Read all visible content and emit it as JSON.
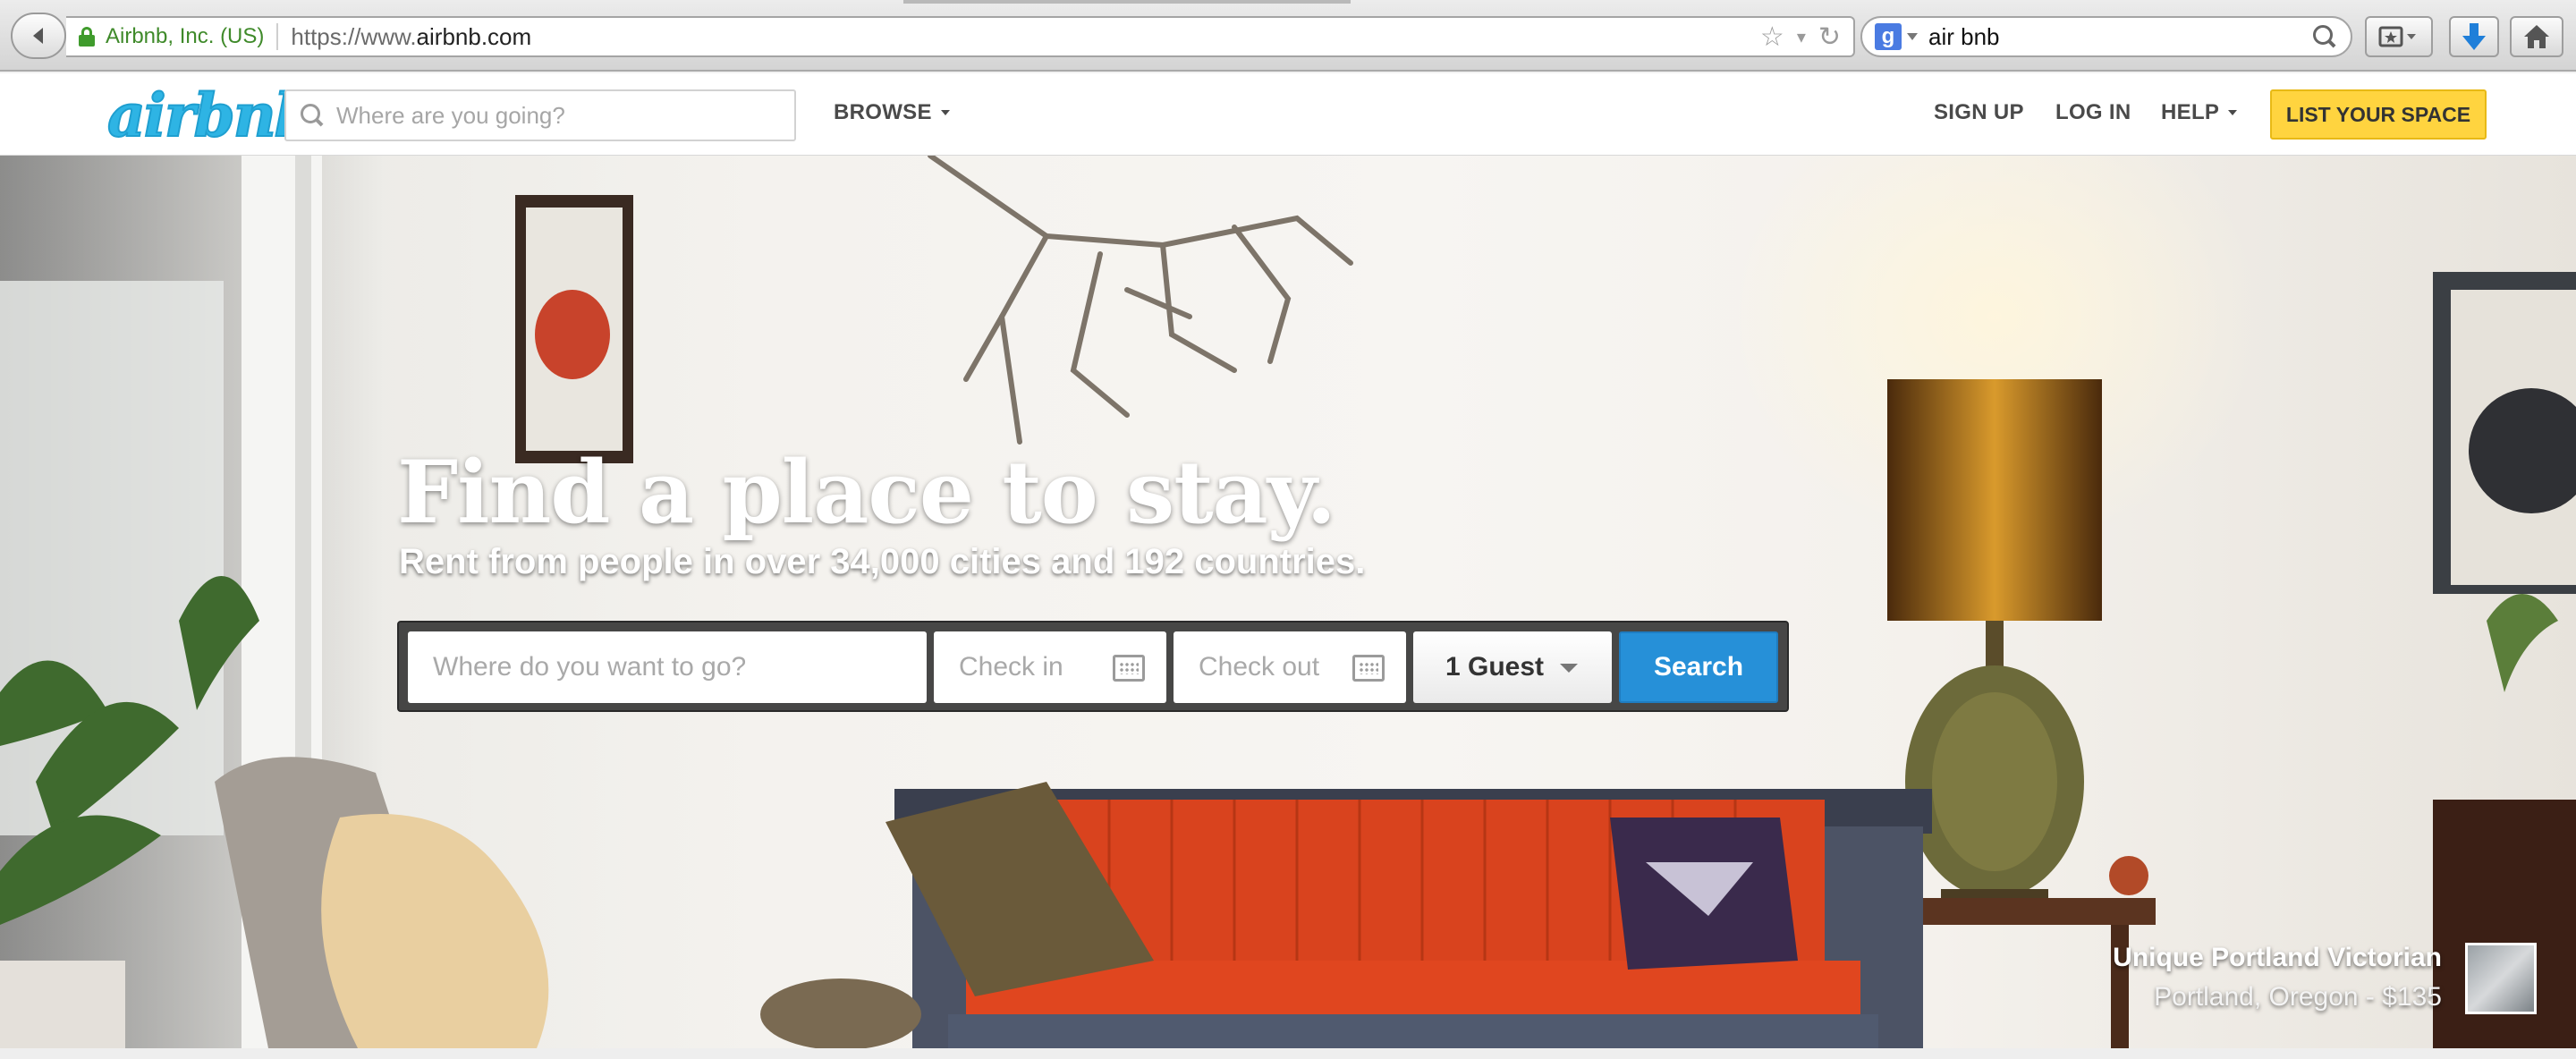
{
  "browser": {
    "identity": "Airbnb, Inc. (US)",
    "url_prefix": "https://www.",
    "url_domain": "airbnb.com",
    "search_query": "air bnb",
    "search_engine_icon": "g"
  },
  "header": {
    "logo": "airbnb",
    "search_placeholder": "Where are you going?",
    "browse_label": "BROWSE",
    "signup_label": "SIGN UP",
    "login_label": "LOG IN",
    "help_label": "HELP",
    "list_space_label": "LIST YOUR SPACE"
  },
  "hero": {
    "title": "Find a place to stay.",
    "subtitle": "Rent from people in over 34,000 cities and 192 countries.",
    "where_placeholder": "Where do you want to go?",
    "checkin_placeholder": "Check in",
    "checkout_placeholder": "Check out",
    "guests_value": "1 Guest",
    "search_label": "Search"
  },
  "caption": {
    "title": "Unique Portland Victorian",
    "subtitle": "Portland, Oregon - $135"
  },
  "colors": {
    "brand": "#2eb4e4",
    "list_space": "#ffd43f",
    "search_button": "#2690d8",
    "sofa": "#e0451f"
  }
}
